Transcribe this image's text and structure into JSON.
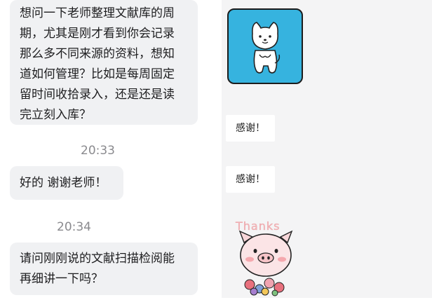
{
  "chat": {
    "left_messages": [
      {
        "lines": [
          "想问一下老师整理文献库的周",
          "期，尤其是刚才看到你会记录",
          "那么多不同来源的资料，想知",
          "道如何管理？比如是每周固定",
          "留时间收拾录入，还是还是读",
          "完立刻入库？"
        ]
      },
      {
        "lines": [
          "好的 谢谢老师！"
        ]
      },
      {
        "lines": [
          "请问刚刚说的文献扫描检阅能",
          "再细讲一下吗？"
        ]
      }
    ],
    "timestamps": [
      "20:33",
      "20:34"
    ],
    "right_messages": [
      {
        "text": "感谢！"
      },
      {
        "text": "感谢！"
      }
    ],
    "stickers": {
      "dog": {
        "bg_color": "#36b3df"
      },
      "pig": {
        "caption": "Thanks"
      }
    }
  }
}
